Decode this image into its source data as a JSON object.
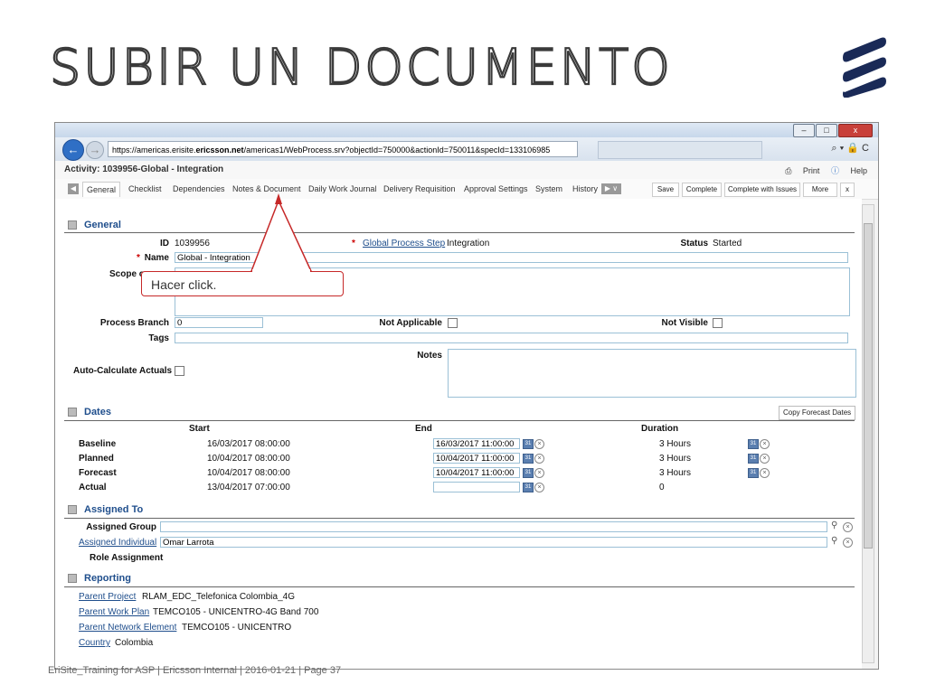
{
  "slide": {
    "title": "SUBIR UN DOCUMENTO",
    "footer": "EriSite_Training for ASP  |  Ericsson Internal  |  2016-01-21  |  Page 37"
  },
  "browser": {
    "url_prefix": "https://americas.erisite.",
    "url_domain": "ericsson.net",
    "url_suffix": "/americas1/WebProcess.srv?objectId=750000&actionId=750011&specId=133106985",
    "window_buttons": [
      "–",
      "□",
      "x"
    ],
    "addr_icons": "⌕ ▾ 🔒 C"
  },
  "activity": {
    "title": "Activity: 1039956-Global - Integration",
    "print_label": "Print",
    "help_label": "Help"
  },
  "tabs": [
    "General",
    "Checklist",
    "Dependencies",
    "Notes & Document",
    "Daily Work Journal",
    "Delivery Requisition",
    "Approval Settings",
    "System",
    "History"
  ],
  "actions": [
    "Save",
    "Complete",
    "Complete with Issues",
    "More",
    "x"
  ],
  "general": {
    "section_title": "General",
    "id_label": "ID",
    "id_value": "1039956",
    "global_process_step_label": "Global Process Step",
    "global_process_step_value": "Integration",
    "status_label": "Status",
    "status_value": "Started",
    "name_label": "Name",
    "name_value": "Global - Integration",
    "scope_label": "Scope o",
    "process_branch_label": "Process Branch",
    "process_branch_value": "0",
    "not_applicable_label": "Not Applicable",
    "not_visible_label": "Not Visible",
    "tags_label": "Tags",
    "notes_label": "Notes",
    "auto_calc_label": "Auto-Calculate Actuals"
  },
  "dates": {
    "section_title": "Dates",
    "copy_button": "Copy Forecast Dates",
    "headers": {
      "start": "Start",
      "end": "End",
      "duration": "Duration"
    },
    "rows": [
      {
        "label": "Baseline",
        "start": "16/03/2017 08:00:00",
        "end": "16/03/2017 11:00:00",
        "duration": "3 Hours"
      },
      {
        "label": "Planned",
        "start": "10/04/2017 08:00:00",
        "end": "10/04/2017 11:00:00",
        "duration": "3 Hours"
      },
      {
        "label": "Forecast",
        "start": "10/04/2017 08:00:00",
        "end": "10/04/2017 11:00:00",
        "duration": "3 Hours"
      },
      {
        "label": "Actual",
        "start": "13/04/2017 07:00:00",
        "end": "",
        "duration": "0"
      }
    ]
  },
  "assigned": {
    "section_title": "Assigned To",
    "group_label": "Assigned Group",
    "group_value": "",
    "individual_label": "Assigned Individual",
    "individual_value": "Omar Larrota",
    "role_label": "Role Assignment"
  },
  "reporting": {
    "section_title": "Reporting",
    "rows": [
      {
        "label": "Parent Project",
        "value": "RLAM_EDC_Telefonica Colombia_4G"
      },
      {
        "label": "Parent Work Plan",
        "value": "TEMCO105 - UNICENTRO-4G Band 700"
      },
      {
        "label": "Parent Network Element",
        "value": "TEMCO105 - UNICENTRO"
      },
      {
        "label": "Country",
        "value": "Colombia"
      }
    ]
  },
  "callout": {
    "text": "Hacer click."
  },
  "colors": {
    "accent_blue": "#1f4e8c",
    "callout_red": "#c62828",
    "logo_navy": "#1a2a57"
  }
}
